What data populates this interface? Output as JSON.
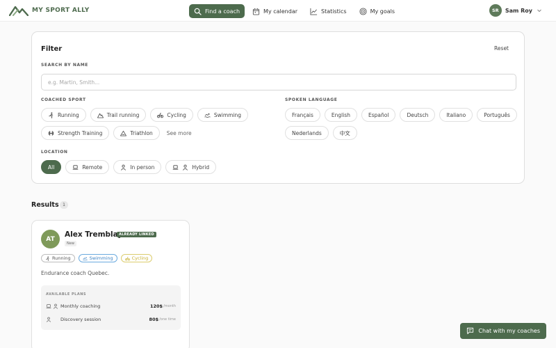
{
  "app": {
    "name": "MY SPORT ALLY"
  },
  "nav": [
    {
      "label": "Find a coach",
      "icon": "search-icon",
      "active": true
    },
    {
      "label": "My calendar",
      "icon": "calendar-icon",
      "active": false
    },
    {
      "label": "Statistics",
      "icon": "chart-icon",
      "active": false
    },
    {
      "label": "My goals",
      "icon": "target-icon",
      "active": false
    }
  ],
  "user": {
    "initials": "SR",
    "name": "Sam Roy"
  },
  "filter": {
    "title": "Filter",
    "reset_label": "Reset",
    "search": {
      "label": "SEARCH BY NAME",
      "placeholder": "e.g. Martin, Smith...",
      "value": ""
    },
    "sport": {
      "label": "COACHED SPORT",
      "options": [
        "Running",
        "Trail running",
        "Cycling",
        "Swimming",
        "Strength Training",
        "Triathlon"
      ],
      "see_more": "See more"
    },
    "language": {
      "label": "SPOKEN LANGUAGE",
      "options": [
        "Français",
        "English",
        "Español",
        "Deutsch",
        "Italiano",
        "Português",
        "Nederlands",
        "中文"
      ]
    },
    "location": {
      "label": "LOCATION",
      "options": [
        "All",
        "Remote",
        "In person",
        "Hybrid"
      ],
      "selected": "All"
    }
  },
  "results": {
    "title": "Results",
    "count": "1",
    "coaches": [
      {
        "initials": "AT",
        "name": "Alex Tremblay",
        "linked_badge": "ALREADY LINKED",
        "new_badge": "New",
        "sports": [
          "Running",
          "Swimming",
          "Cycling"
        ],
        "description": "Endurance coach Quebec.",
        "plans_label": "AVAILABLE PLANS",
        "plans": [
          {
            "name": "Monthly coaching",
            "price": "120$",
            "unit": "/month"
          },
          {
            "name": "Discovery session",
            "price": "80$",
            "unit": "/one time"
          }
        ]
      }
    ]
  },
  "chat": {
    "label": "Chat with my coaches"
  },
  "colors": {
    "accent": "#4d6b4d",
    "avatar_user": "#5e7a5a",
    "avatar_coach": "#7f9a5a",
    "swimming": "#3b82c4",
    "cycling": "#c9b236"
  }
}
